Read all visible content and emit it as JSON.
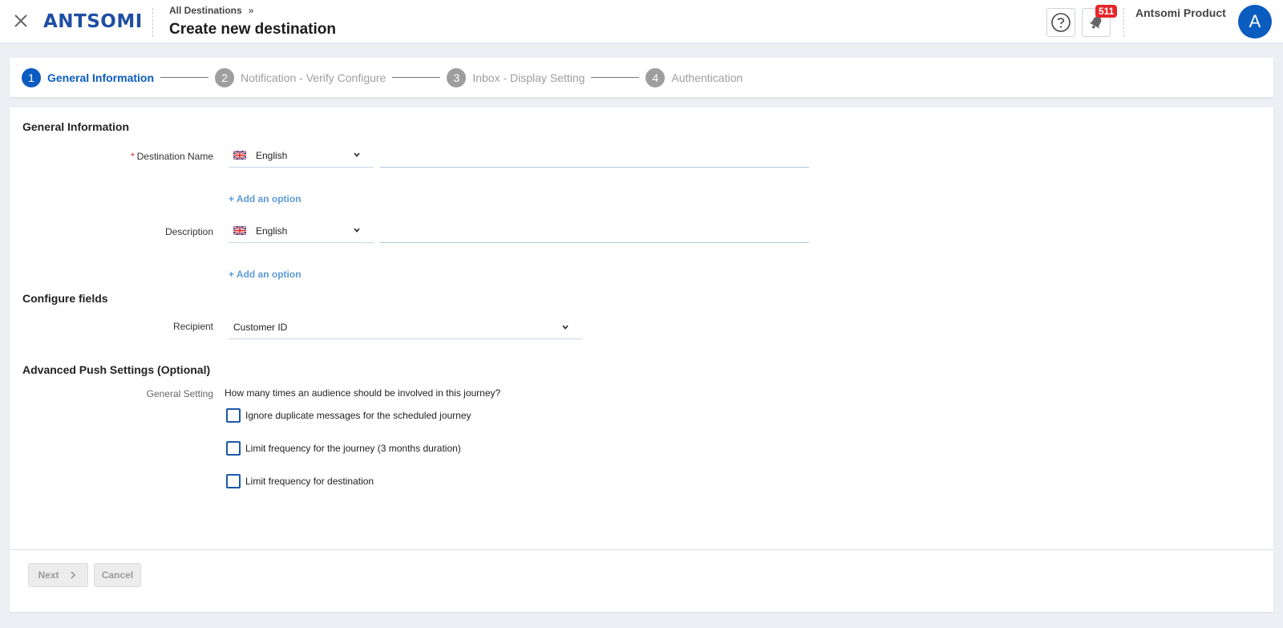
{
  "header": {
    "close_icon": "close-icon",
    "logo_text": "ANTSOMI",
    "breadcrumb": "All Destinations",
    "breadcrumb_sep": "»",
    "title": "Create new destination",
    "help_icon": "help-circle-icon",
    "bell_icon": "bell-icon",
    "notification_count": "511",
    "user_name": "Antsomi Product",
    "avatar_initial": "A"
  },
  "stepper": {
    "steps": [
      {
        "num": "1",
        "label": "General Information",
        "active": true
      },
      {
        "num": "2",
        "label": "Notification - Verify Configure",
        "active": false
      },
      {
        "num": "3",
        "label": "Inbox - Display Setting",
        "active": false
      },
      {
        "num": "4",
        "label": "Authentication",
        "active": false
      }
    ]
  },
  "form": {
    "general_title": "General Information",
    "destination_name": {
      "label": "Destination Name",
      "required_mark": "*",
      "language": "English",
      "value": ""
    },
    "add_option_1": "+ Add an option",
    "description": {
      "label": "Description",
      "language": "English",
      "value": ""
    },
    "add_option_2": "+ Add an option",
    "configure_title": "Configure fields",
    "recipient": {
      "label": "Recipient",
      "value": "Customer ID"
    },
    "advanced_title": "Advanced Push Settings (Optional)",
    "general_setting_label": "General Setting",
    "question": "How many times an audience should be involved in this journey?",
    "options": [
      {
        "label": "Ignore duplicate messages for the scheduled journey",
        "checked": false
      },
      {
        "label": "Limit frequency for the journey (3 months duration)",
        "checked": false
      },
      {
        "label": "Limit frequency for destination",
        "checked": false
      }
    ]
  },
  "footer": {
    "next_label": "Next",
    "cancel_label": "Cancel"
  },
  "colors": {
    "accent": "#0b5cbf",
    "badge": "#e5262a",
    "link": "#5d9ad6"
  }
}
